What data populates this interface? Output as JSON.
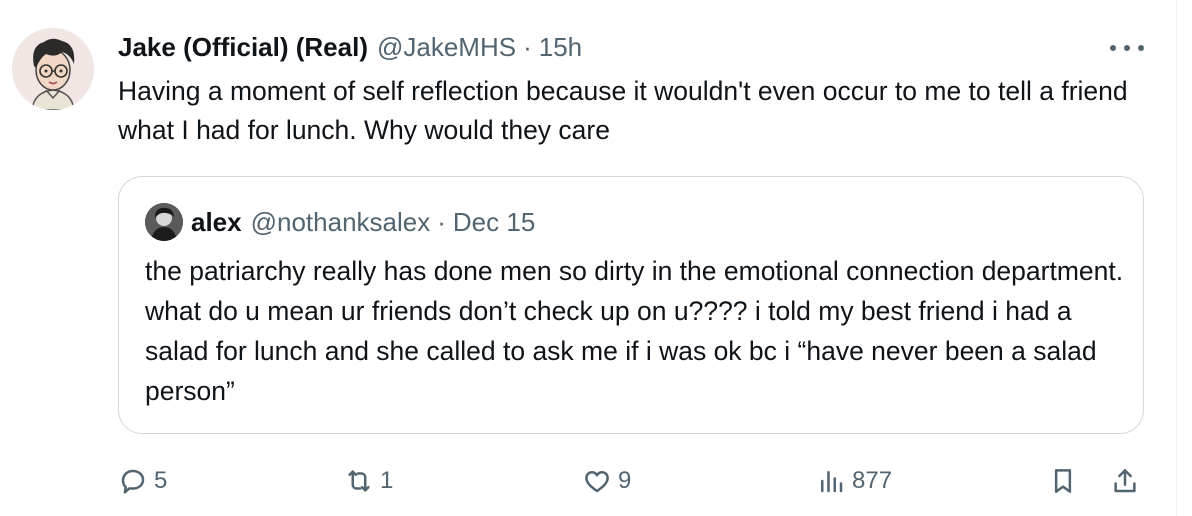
{
  "tweet": {
    "author_name": "Jake (Official) (Real)",
    "author_handle": "@JakeMHS",
    "separator": "·",
    "time": "15h",
    "text": "Having a moment of self reflection because it wouldn't even occur to me to tell a friend what I had for lunch. Why would they care"
  },
  "quoted_tweet": {
    "author_name": "alex",
    "author_handle": "@nothanksalex",
    "separator": "·",
    "date": "Dec 15",
    "text": "the patriarchy really has done men so dirty in the emotional connection department. what do u mean ur friends don’t check up on u???? i told my best friend i had a salad for lunch and she called to ask me if i was ok bc i “have never been a salad person”"
  },
  "actions": {
    "replies": "5",
    "reposts": "1",
    "likes": "9",
    "views": "877"
  },
  "icons": {
    "reply": "reply-icon",
    "repost": "repost-icon",
    "like": "heart-icon",
    "views": "analytics-icon",
    "bookmark": "bookmark-icon",
    "share": "share-icon",
    "more": "more-dots-icon"
  },
  "colors": {
    "text_primary": "#0f1419",
    "text_secondary": "#536471",
    "border": "#cfd9de"
  }
}
